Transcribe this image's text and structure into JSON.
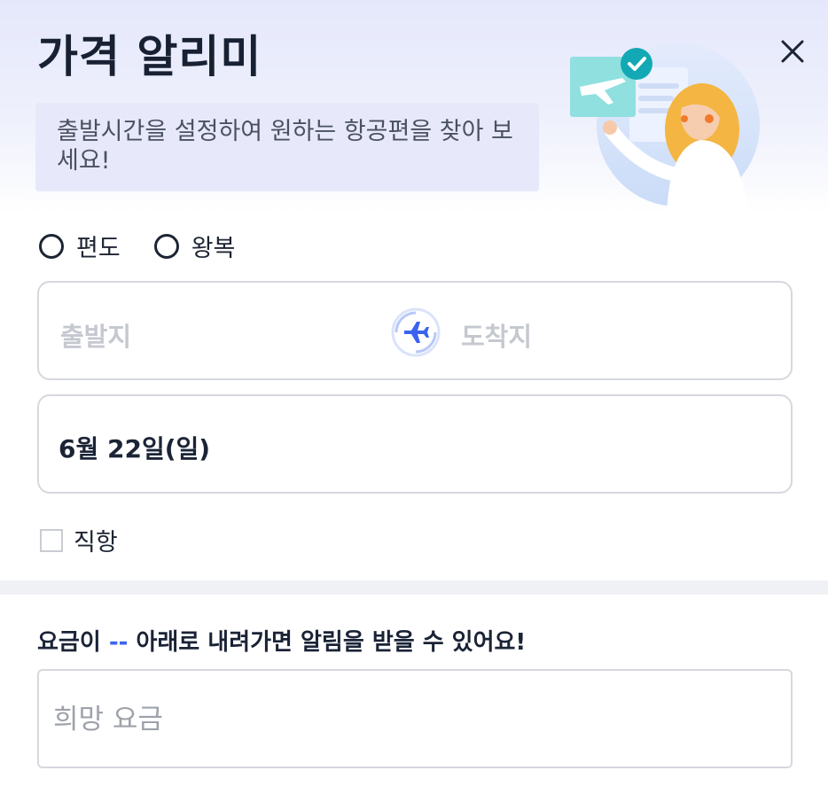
{
  "header": {
    "title": "가격 알리미",
    "subtitle": "출발시간을 설정하여 원하는 항공편을 찾아 보세요!",
    "close_icon": "close-icon",
    "illustration": "traveler-illustration"
  },
  "trip_type": {
    "one_way_label": "편도",
    "round_trip_label": "왕복"
  },
  "route": {
    "origin_placeholder": "출발지",
    "destination_placeholder": "도착지",
    "swap_icon": "airplane-icon"
  },
  "date": {
    "value": "6월 22일(일)"
  },
  "direct": {
    "label": "직항"
  },
  "price_alert": {
    "notice_prefix": "요금이 ",
    "notice_dash": "--",
    "notice_suffix": " 아래로 내려가면 알림을 받을 수 있어요!",
    "input_placeholder": "희망 요금"
  },
  "colors": {
    "accent": "#3b63f0",
    "header_gradient": "#e5e8fb",
    "subtitle_box": "#e7e9fb",
    "divider": "#f0f1f4",
    "border": "#d6d8de"
  }
}
